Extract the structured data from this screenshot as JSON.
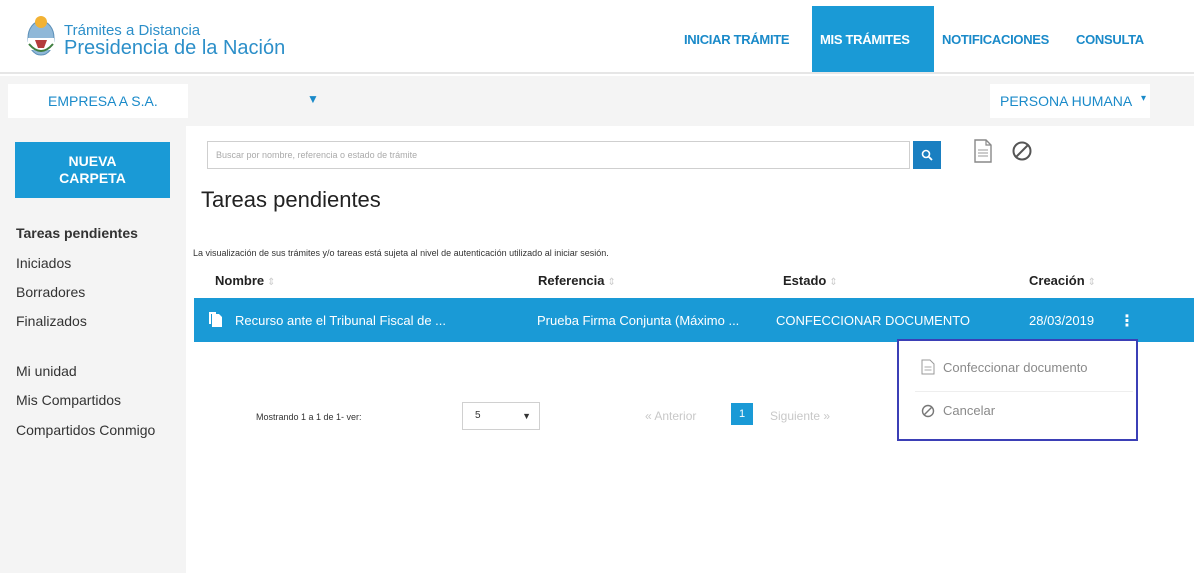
{
  "header": {
    "brand_line1": "Trámites a Distancia",
    "brand_line2": "Presidencia de la Nación",
    "nav": [
      {
        "label": "INICIAR TRÁMITE",
        "active": false
      },
      {
        "label": "MIS TRÁMITES",
        "active": true
      },
      {
        "label": "NOTIFICACIONES",
        "active": false
      },
      {
        "label": "CONSULTA",
        "active": false
      }
    ]
  },
  "subbar": {
    "company": "EMPRESA A S.A.",
    "persona": "PERSONA HUMANA"
  },
  "sidebar": {
    "new_folder_line1": "NUEVA",
    "new_folder_line2": "CARPETA",
    "items": [
      "Tareas pendientes",
      "Iniciados",
      "Borradores",
      "Finalizados",
      "Mi unidad",
      "Mis Compartidos",
      "Compartidos Conmigo"
    ]
  },
  "search": {
    "placeholder": "Buscar por nombre, referencia o estado de trámite"
  },
  "main": {
    "title": "Tareas pendientes",
    "notice": "La visualización de sus trámites y/o tareas está sujeta al nivel de autenticación utilizado al iniciar sesión.",
    "columns": [
      "Nombre",
      "Referencia",
      "Estado",
      "Creación"
    ],
    "rows": [
      {
        "nombre": "Recurso ante el Tribunal Fiscal de ...",
        "referencia": "Prueba Firma Conjunta (Máximo ...",
        "estado": "CONFECCIONAR DOCUMENTO",
        "creacion": "28/03/2019"
      }
    ]
  },
  "pagination": {
    "showing": "Mostrando 1 a 1 de 1- ver:",
    "per_page": "5",
    "prev": "« Anterior",
    "current": "1",
    "next": "Siguiente »"
  },
  "menu": {
    "items": [
      "Confeccionar documento",
      "Cancelar"
    ]
  },
  "colors": {
    "accent": "#1a9ad6",
    "link": "#1a8ac9",
    "menu_border": "#3b3fb6"
  }
}
